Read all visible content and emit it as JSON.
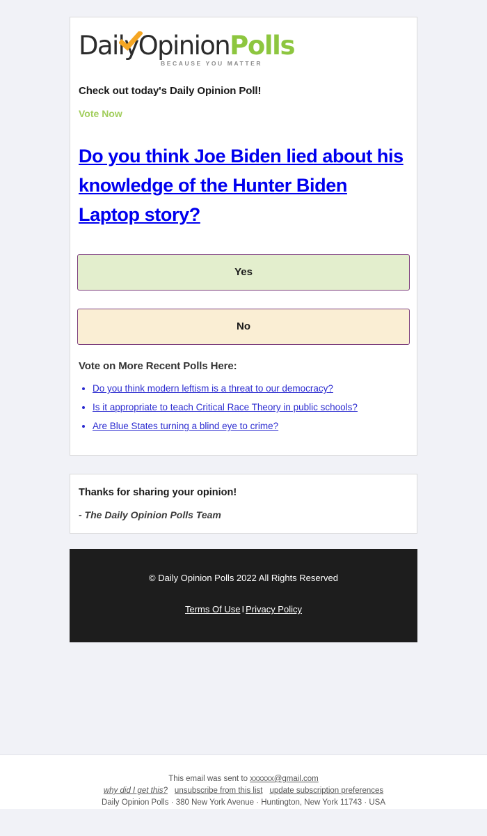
{
  "brand": {
    "logo_part1": "Daily",
    "logo_part2": "pinion",
    "logo_part3": "Polls",
    "logo_o": "O",
    "tagline": "BECAUSE YOU MATTER",
    "colors": {
      "green": "#8dc63f",
      "dark": "#2b2b2b",
      "orange": "#f5a623",
      "link_blue": "#0000ee",
      "button_border": "#7d3f7d",
      "yes_fill": "#e3eecd",
      "no_fill": "#faeed4",
      "footer_bg": "#1d1d1d",
      "page_bg": "#f1f2f7"
    }
  },
  "intro": {
    "headline": "Check out today's Daily Opinion Poll!",
    "cta": "Vote Now"
  },
  "poll": {
    "question": "Do you think Joe Biden lied about his knowledge of the Hunter Biden Laptop story?",
    "options": [
      {
        "label": "Yes"
      },
      {
        "label": "No"
      }
    ]
  },
  "more_polls": {
    "heading": "Vote on More Recent Polls Here:",
    "items": [
      {
        "label": "Do you think modern leftism is a threat to our democracy?"
      },
      {
        "label": "Is it appropriate to teach Critical Race Theory in public schools?"
      },
      {
        "label": "Are Blue States turning a blind eye to crime?"
      }
    ]
  },
  "thanks": {
    "line1": "Thanks for sharing your opinion!",
    "signature": "- The Daily Opinion Polls Team"
  },
  "footer": {
    "copyright": "© Daily Opinion Polls 2022 All Rights Reserved",
    "terms_label": "Terms Of Use",
    "separator": "I",
    "privacy_label": "Privacy Policy"
  },
  "mailchimp": {
    "sent_to_prefix": "This email was sent to ",
    "email": "xxxxxx@gmail.com",
    "why_label": "why did I get this?",
    "unsubscribe_label": "unsubscribe from this list",
    "update_label": "update subscription preferences",
    "address": "Daily Opinion Polls · 380 New York Avenue · Huntington, New York 11743 · USA"
  }
}
